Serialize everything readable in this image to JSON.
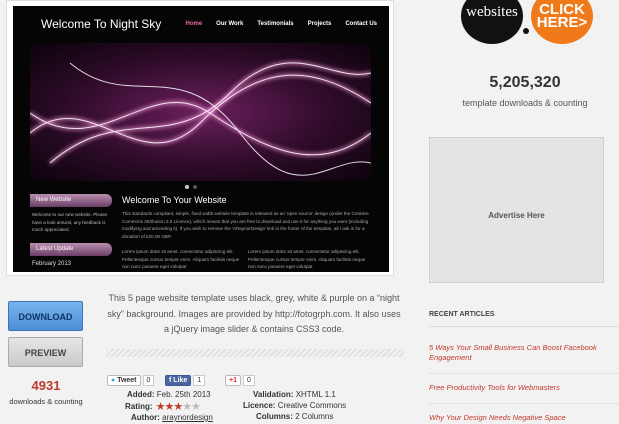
{
  "preview": {
    "site_title": "Welcome To Night Sky",
    "nav": [
      "Home",
      "Our Work",
      "Testimonials",
      "Projects",
      "Contact Us"
    ],
    "sidebar": {
      "new_website_heading": "New Website",
      "new_website_text": "Welcome to our new website. Please have a look around, any feedback is much appreciated.",
      "latest_update_heading": "Latest Update",
      "latest_update_date": "February 2013"
    },
    "main_heading": "Welcome To Your Website",
    "main_text": "This standards compliant, simple, fixed width website template is released as an 'open source' design (under the Creative Commons Attribution 3.0 Licence), which means that you are free to download and use it for anything you want (including modifying and amending it). If you wish to remove the 'ARaynorDesign' link in the footer of the template, all I ask is for a donation of £20.00 GBP.",
    "col1_text": "Lorem ipsum dolor sit amet, consectetur adipiscing elit. Pellentesque cursus tempor enim. Aliquam facilisis neque non nunc posuere eget volutpat",
    "col2_text": "Lorem ipsum dolor sit amet, consectetur adipiscing elit. Pellentesque cursus tempor enim. Aliquam facilisis neque non nunc posuere eget volutpat"
  },
  "promo": {
    "left": "websites",
    "right_line1": "CLICK",
    "right_line2": "HERE>"
  },
  "counter": {
    "value": "5,205,320",
    "label": "template downloads & counting"
  },
  "advert": {
    "label": "Advertise Here"
  },
  "recent": {
    "title": "RECENT ARTICLES",
    "articles": [
      "5 Ways Your Small Business Can Boost Facebook Engagement",
      "Free Productivity Tools for Webmasters",
      "Why Your Design Needs Negative Space"
    ]
  },
  "buttons": {
    "download": "DOWNLOAD",
    "preview": "PREVIEW"
  },
  "downloads": {
    "count": "4931",
    "label": "downloads & counting"
  },
  "description": "This 5 page website template uses black, grey, white & purple on a “night sky” background. Images are provided by http://fotogrph.com. It also uses a jQuery image slider & contains CSS3 code.",
  "share": {
    "tweet_label": "Tweet",
    "tweet_count": "0",
    "like_label": "Like",
    "like_count": "1",
    "gplus_label": "+1",
    "gplus_count": "0"
  },
  "meta": {
    "added_label": "Added:",
    "added_value": "Feb. 25th 2013",
    "rating_label": "Rating:",
    "rating_value": 3,
    "rating_max": 5,
    "author_label": "Author:",
    "author_value": "araynordesign",
    "validation_label": "Validation:",
    "validation_value": "XHTML 1.1",
    "licence_label": "Licence:",
    "licence_value": "Creative Commons",
    "columns_label": "Columns:",
    "columns_value": "2 Columns"
  },
  "colors": {
    "accent": "#c0392b",
    "download_button": "#5b9be0",
    "promo_orange": "#f07a1a"
  }
}
